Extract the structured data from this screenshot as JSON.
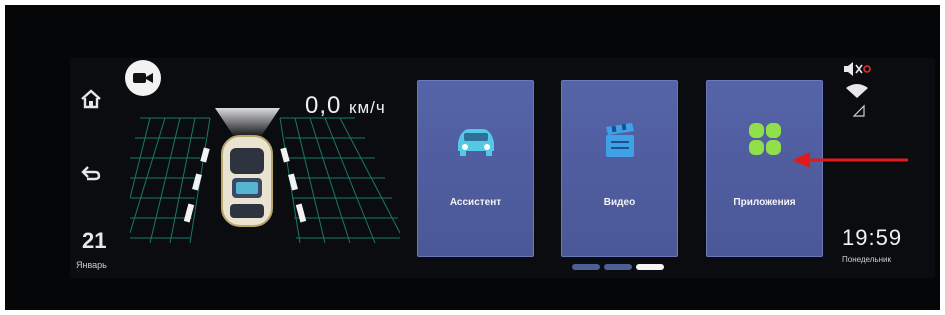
{
  "nav": {
    "home_icon": "home-icon",
    "back_icon": "back-icon",
    "date_day": "21",
    "date_month": "Январь"
  },
  "camera": {
    "icon": "camera-icon"
  },
  "speed": {
    "value": "0,0",
    "unit": "км/ч"
  },
  "apps": [
    {
      "label": "Ассистент",
      "icon": "car-icon"
    },
    {
      "label": "Видео",
      "icon": "video-icon"
    },
    {
      "label": "Приложения",
      "icon": "apps-grid-icon"
    }
  ],
  "pager": {
    "pages": 3,
    "active_index": 2
  },
  "status": {
    "mute_icon": "mute-icon",
    "wifi_icon": "wifi-icon",
    "signal_icon": "signal-icon"
  },
  "clock": {
    "time": "19:59",
    "weekday": "Понедельник"
  },
  "colors": {
    "tile": "#5160a3",
    "accent_green": "#8fe04a",
    "arrow_red": "#e01a1a",
    "car_accent": "#5ac8e0"
  }
}
